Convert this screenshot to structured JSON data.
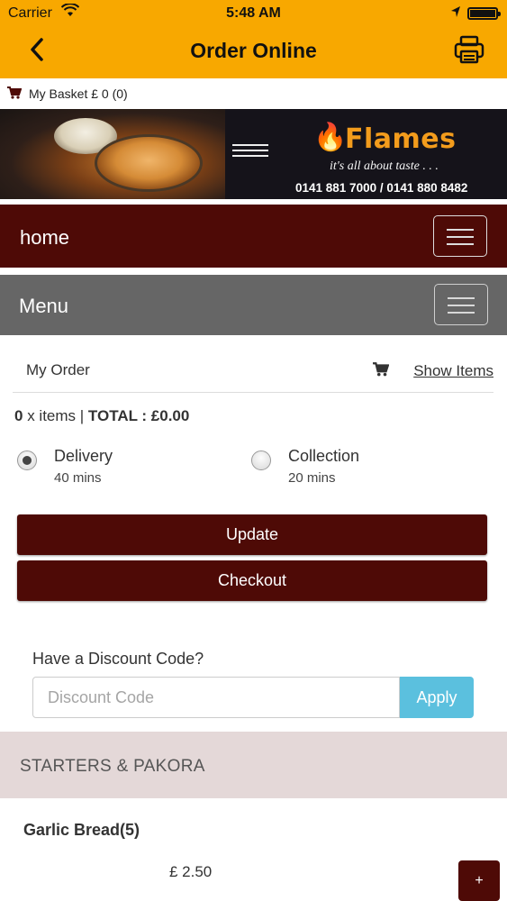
{
  "status_bar": {
    "carrier": "Carrier",
    "time": "5:48 AM"
  },
  "nav": {
    "title": "Order Online",
    "back_icon": "chevron-left-icon",
    "print_icon": "printer-icon"
  },
  "basket": {
    "label": "My Basket £ 0 (0)"
  },
  "banner": {
    "brand": "Flames",
    "tagline": "it's all about taste . . .",
    "phones": "0141 881 7000 / 0141 880 8482"
  },
  "home_bar": {
    "label": "home"
  },
  "menu_bar": {
    "label": "Menu"
  },
  "order": {
    "title": "My Order",
    "show_items": "Show Items",
    "count": "0",
    "items_suffix": " x items | ",
    "total": "TOTAL : £0.00"
  },
  "fulfilment": {
    "options": [
      {
        "name": "Delivery",
        "time": "40 mins",
        "selected": true
      },
      {
        "name": "Collection",
        "time": "20 mins",
        "selected": false
      }
    ]
  },
  "actions": {
    "update": "Update",
    "checkout": "Checkout"
  },
  "discount": {
    "label": "Have a Discount Code?",
    "placeholder": "Discount Code",
    "value": "",
    "apply": "Apply"
  },
  "category": {
    "label": "STARTERS & PAKORA"
  },
  "items": [
    {
      "name": "Garlic Bread(5)",
      "price": "£ 2.50",
      "add_label": "+"
    }
  ],
  "colors": {
    "header": "#f8a800",
    "brand_dark": "#4e0a06",
    "menu_grey": "#666666",
    "apply_blue": "#5bc0de",
    "category_bg": "#e4d8d8"
  }
}
